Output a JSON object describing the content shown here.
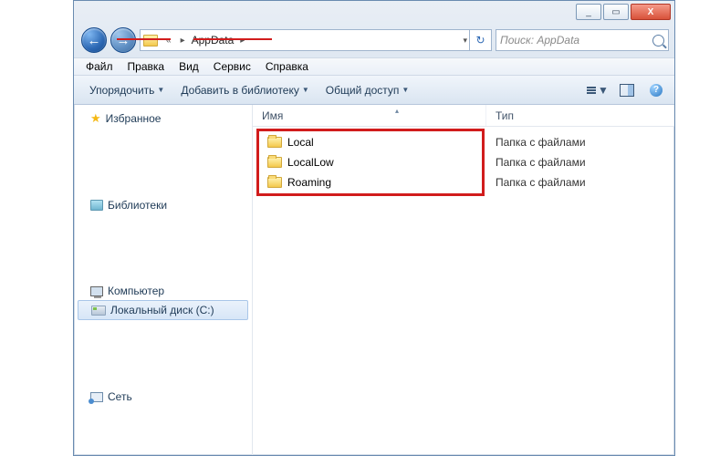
{
  "titlebar": {
    "min": "_",
    "max": "▭",
    "close": "X"
  },
  "nav": {
    "back": "←",
    "fwd": "→",
    "chev": "«",
    "path_segment": "AppData",
    "sep": "▸",
    "dd": "▾",
    "refresh": "↻"
  },
  "search": {
    "placeholder": "Поиск: AppData"
  },
  "menubar": [
    "Файл",
    "Правка",
    "Вид",
    "Сервис",
    "Справка"
  ],
  "cmdbar": {
    "organize": "Упорядочить",
    "add_library": "Добавить в библиотеку",
    "share": "Общий доступ",
    "tri": "▼"
  },
  "columns": {
    "name": "Имя",
    "type": "Тип",
    "sort": "▴"
  },
  "rows": [
    {
      "name": "Local",
      "type": "Папка с файлами"
    },
    {
      "name": "LocalLow",
      "type": "Папка с файлами"
    },
    {
      "name": "Roaming",
      "type": "Папка с файлами"
    }
  ],
  "sidebar": {
    "favorites": "Избранное",
    "libraries": "Библиотеки",
    "computer": "Компьютер",
    "local_disk": "Локальный диск (C:)",
    "network": "Сеть"
  }
}
